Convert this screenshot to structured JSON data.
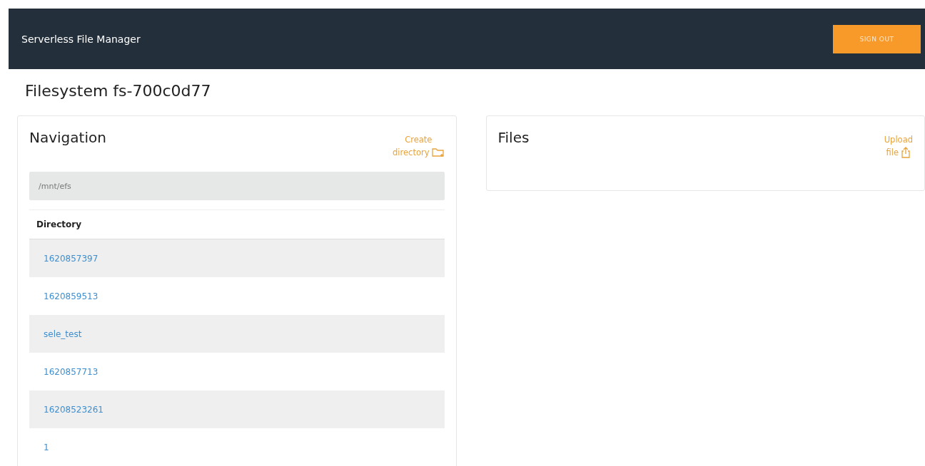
{
  "header": {
    "title": "Serverless File Manager",
    "sign_out": "SIGN OUT"
  },
  "page_title": "Filesystem fs-700c0d77",
  "navigation": {
    "title": "Navigation",
    "action": [
      "Create",
      "directory"
    ],
    "path": "/mnt/efs",
    "column": "Directory",
    "rows": [
      "1620857397",
      "1620859513",
      "sele_test",
      "1620857713",
      "16208523261",
      "1"
    ]
  },
  "files": {
    "title": "Files",
    "action": [
      "Upload",
      "file"
    ]
  }
}
